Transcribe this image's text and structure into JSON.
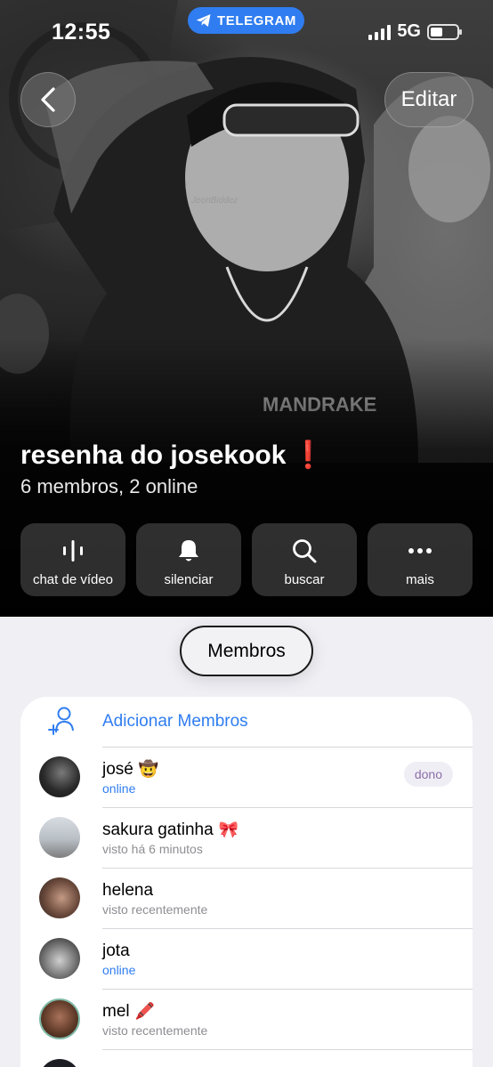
{
  "status_bar": {
    "time": "12:55",
    "telegram_label": "TELEGRAM",
    "network": "5G",
    "battery_level": 0.45
  },
  "header": {
    "back_icon": "chevron-left-icon",
    "edit_label": "Editar",
    "photo_watermark": "JeonBiddez",
    "title": "resenha do josekook",
    "title_mark": "❗",
    "subtitle": "6 membros, 2 online"
  },
  "actions": [
    {
      "icon": "voice-chat-icon",
      "label": "chat de vídeo"
    },
    {
      "icon": "bell-icon",
      "label": "silenciar"
    },
    {
      "icon": "search-icon",
      "label": "buscar"
    },
    {
      "icon": "more-icon",
      "label": "mais"
    }
  ],
  "tabs": {
    "members_label": "Membros"
  },
  "members": {
    "add_label": "Adicionar Membros",
    "list": [
      {
        "name": "josé",
        "emoji": "🤠",
        "status": "online",
        "badge": "dono"
      },
      {
        "name": "sakura gatinha",
        "emoji": "🎀",
        "status": "visto há 6 minutos"
      },
      {
        "name": "helena",
        "emoji": "",
        "status": "visto recentemente"
      },
      {
        "name": "jota",
        "emoji": "",
        "status": "online"
      },
      {
        "name": "mel",
        "emoji": "🖍️",
        "status": "visto recentemente"
      }
    ]
  },
  "colors": {
    "accent": "#2f7df0",
    "online": "#2f7df0",
    "badge_text": "#8a6ea8",
    "title_mark": "#e0222b"
  }
}
